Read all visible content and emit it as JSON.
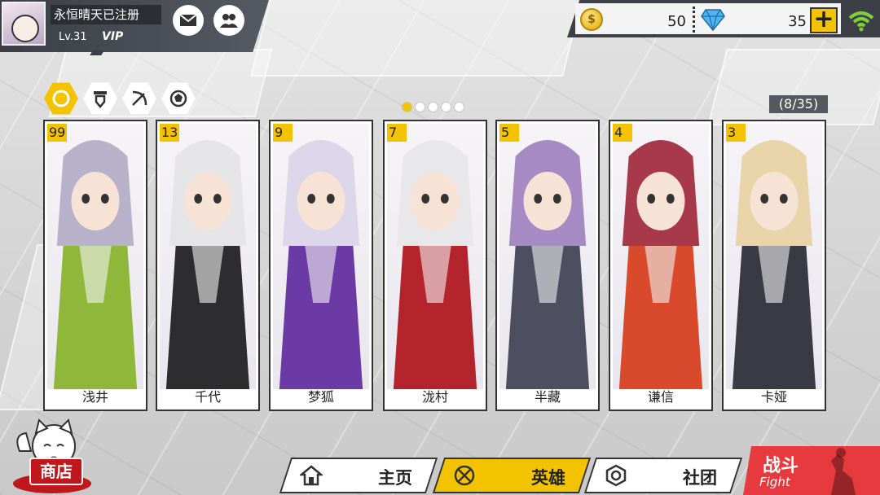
{
  "player": {
    "name": "永恒晴天已注册",
    "level": "Lv.31",
    "vip": "VIP"
  },
  "currency": {
    "coins": "50",
    "gems": "35",
    "coin_symbol": "$"
  },
  "filters": [
    "all-filter-icon",
    "warrior-class-icon",
    "archer-class-icon",
    "mage-class-icon"
  ],
  "page_indicator": {
    "pages": 5,
    "current": 1
  },
  "hero_count": "(8/35)",
  "heroes": [
    {
      "level": "99",
      "name": "浅井",
      "hair": "#b7b2c9",
      "outfit": "#8fb73a"
    },
    {
      "level": "13",
      "name": "千代",
      "hair": "#e5e5e8",
      "outfit": "#2d2d30"
    },
    {
      "level": "9",
      "name": "梦狐",
      "hair": "#dcd6ea",
      "outfit": "#6b3aa5"
    },
    {
      "level": "7",
      "name": "泷村",
      "hair": "#e8e8ea",
      "outfit": "#b3242d"
    },
    {
      "level": "5",
      "name": "半藏",
      "hair": "#a58ac4",
      "outfit": "#4d4e60"
    },
    {
      "level": "4",
      "name": "谦信",
      "hair": "#a8394a",
      "outfit": "#d84a2b"
    },
    {
      "level": "3",
      "name": "卡娅",
      "hair": "#e8d4a8",
      "outfit": "#3a3a44"
    }
  ],
  "nav": {
    "shop": "商店",
    "home": "主页",
    "heroes": "英雄",
    "guild": "社团",
    "fight": "战斗",
    "fight_sub": "Fight"
  },
  "colors": {
    "accent": "#f3c300",
    "fight": "#e63a3f",
    "panel": "#3c3f46"
  }
}
